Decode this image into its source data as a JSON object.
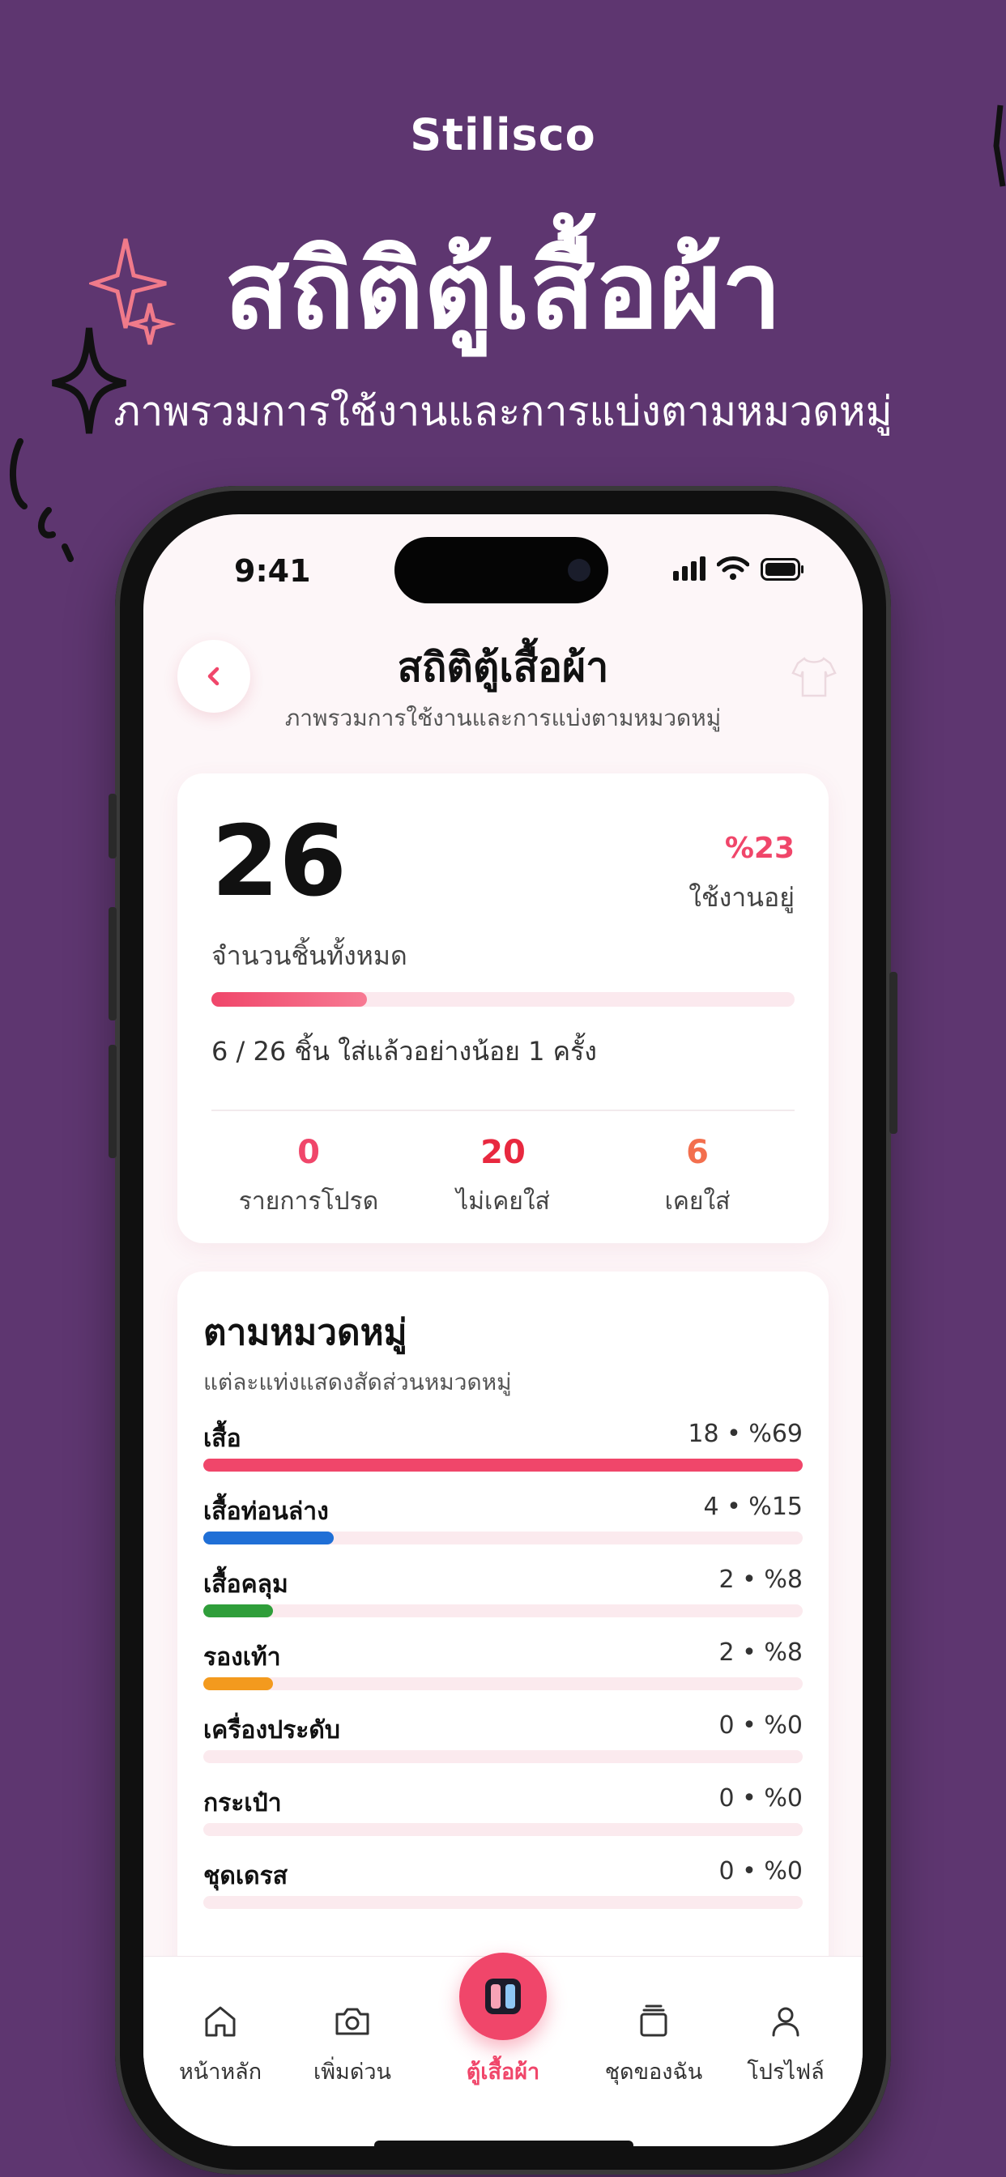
{
  "promo": {
    "brand": "Stilisco",
    "title": "สถิติตู้เสื้อผ้า",
    "subtitle": "ภาพรวมการใช้งานและการแบ่งตามหมวดหมู่"
  },
  "status_bar": {
    "time": "9:41"
  },
  "header": {
    "title": "สถิติตู้เสื้อผ้า",
    "subtitle": "ภาพรวมการใช้งานและการแบ่งตามหมวดหมู่"
  },
  "summary": {
    "total": "26",
    "total_label": "จำนวนชิ้นทั้งหมด",
    "usage_percent": "%23",
    "usage_label": "ใช้งานอยู่",
    "usage_fraction": 0.23,
    "worn_text": "6 / 26 ชิ้น ใส่แล้วอย่างน้อย 1 ครั้ง",
    "stats": [
      {
        "value": "0",
        "label": "รายการโปรด",
        "color": "#f0466a"
      },
      {
        "value": "20",
        "label": "ไม่เคยใส่",
        "color": "#e8283f"
      },
      {
        "value": "6",
        "label": "เคยใส่",
        "color": "#f36f4e"
      }
    ]
  },
  "categories": {
    "title": "ตามหมวดหมู่",
    "subtitle": "แต่ละแท่งแสดงสัดส่วนหมวดหมู่",
    "items": [
      {
        "name": "เสื้อ",
        "value": "18 • %69",
        "fraction": 0.69,
        "color": "#f0466a"
      },
      {
        "name": "เสื้อท่อนล่าง",
        "value": "4 • %15",
        "fraction": 0.15,
        "color": "#1f6fd6"
      },
      {
        "name": "เสื้อคลุม",
        "value": "2 • %8",
        "fraction": 0.08,
        "color": "#2f9e3a"
      },
      {
        "name": "รองเท้า",
        "value": "2 • %8",
        "fraction": 0.08,
        "color": "#f39a1e"
      },
      {
        "name": "เครื่องประดับ",
        "value": "0 • %0",
        "fraction": 0,
        "color": "#cccccc"
      },
      {
        "name": "กระเป๋า",
        "value": "0 • %0",
        "fraction": 0,
        "color": "#cccccc"
      },
      {
        "name": "ชุดเดรส",
        "value": "0 • %0",
        "fraction": 0,
        "color": "#cccccc"
      }
    ]
  },
  "tabs": [
    {
      "label": "หน้าหลัก",
      "icon": "home-icon"
    },
    {
      "label": "เพิ่มด่วน",
      "icon": "camera-icon"
    },
    {
      "label": "ตู้เสื้อผ้า",
      "icon": "wardrobe-icon",
      "active": true
    },
    {
      "label": "ชุดของฉัน",
      "icon": "outfits-icon"
    },
    {
      "label": "โปรไฟล์",
      "icon": "profile-icon"
    }
  ]
}
